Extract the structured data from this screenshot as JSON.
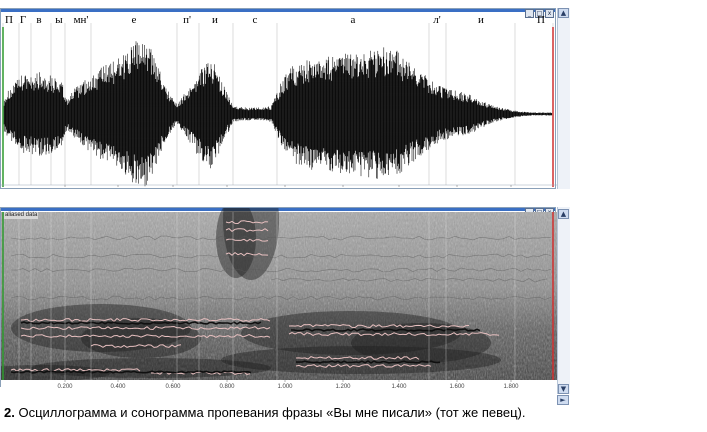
{
  "phonemes": [
    "П",
    "Г",
    "в",
    "ы",
    "мн'",
    "е",
    "п'",
    "и",
    "с",
    "а",
    "л'",
    "и",
    "П"
  ],
  "time_ticks": [
    "0.200",
    "0.400",
    "0.600",
    "0.800",
    "1.000",
    "1.200",
    "1.400",
    "1.600",
    "1.800"
  ],
  "spectrogram_tag": "aliased data",
  "window_buttons": [
    "_",
    "□",
    "x"
  ],
  "scroll_arrows": {
    "up": "▲",
    "down": "▼",
    "right": "►"
  },
  "caption": {
    "number": "2.",
    "text": " Осциллограмма и сонограмма пропевания фразы «Вы мне писали» (тот же певец)."
  },
  "colors": {
    "window_border": "#8aa0b8",
    "titlebar": "#3a6fc4",
    "start_marker": "#2e9a2e",
    "end_marker": "#d03030",
    "formant_trace": "#e8c0c0"
  }
}
